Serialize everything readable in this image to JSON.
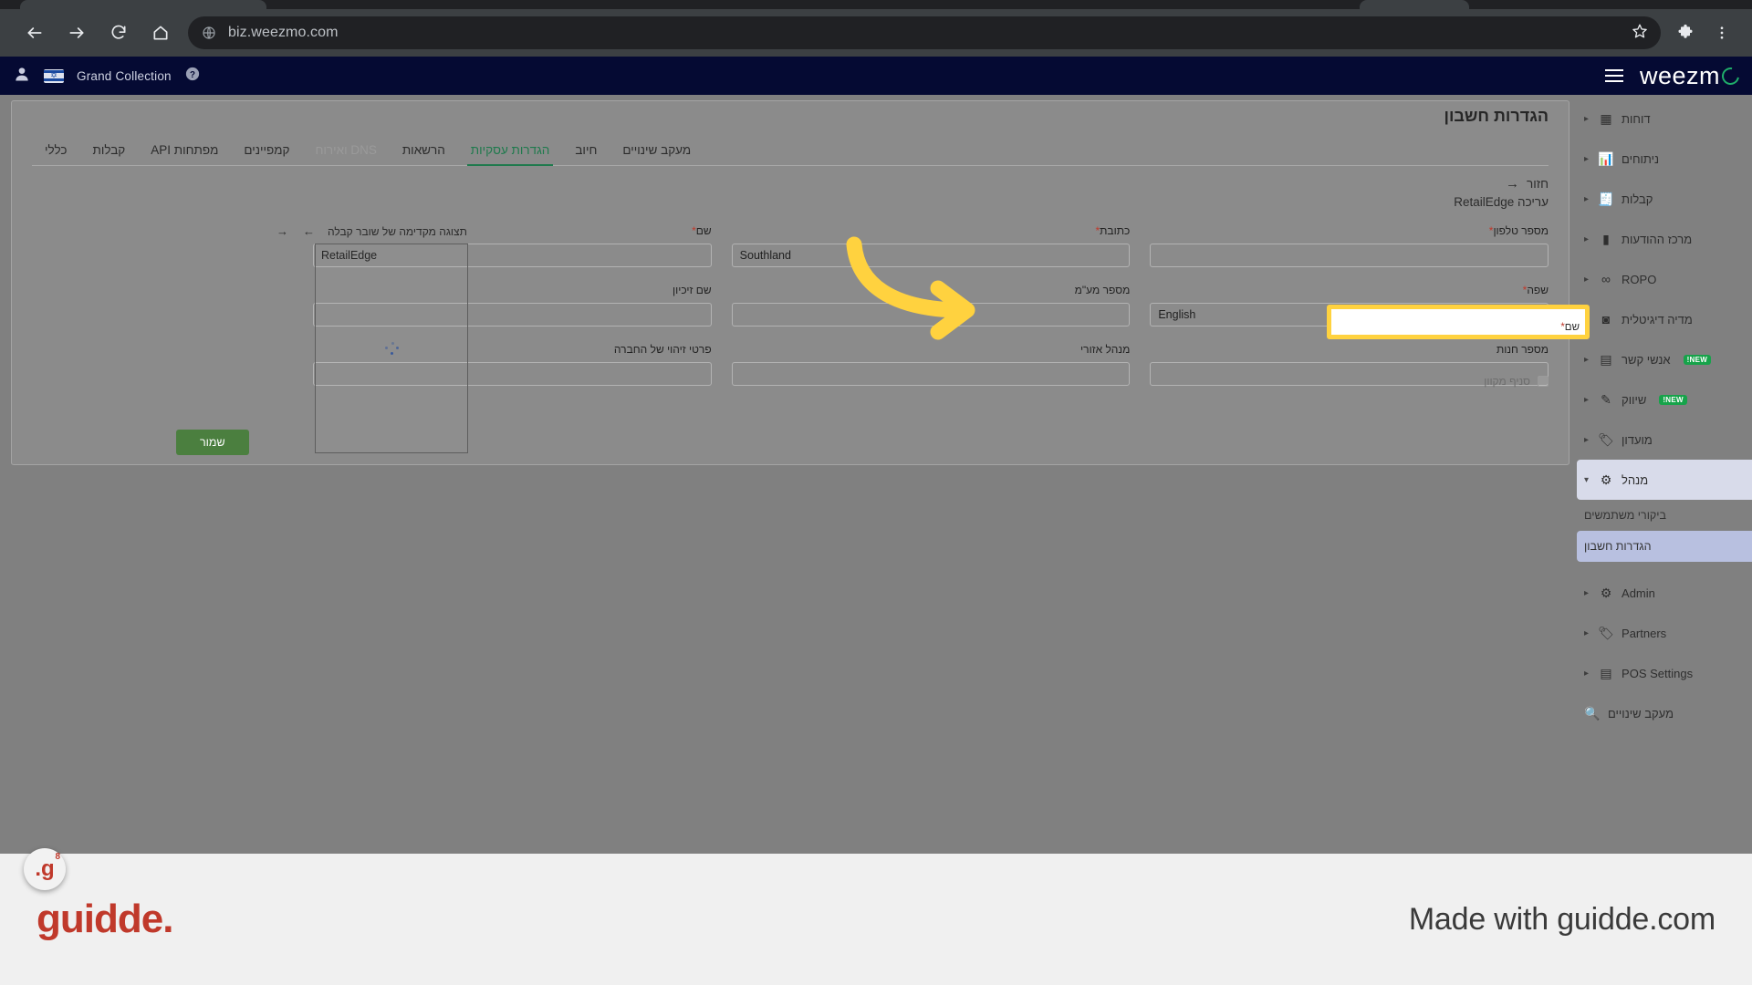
{
  "browser": {
    "url": "biz.weezmo.com",
    "back_icon": "back-arrow-icon",
    "forward_icon": "forward-arrow-icon",
    "reload_icon": "reload-icon",
    "home_icon": "home-icon",
    "site_icon": "globe-icon",
    "bookmark_icon": "star-icon",
    "extensions_icon": "puzzle-icon",
    "menu_icon": "three-dot-menu-icon"
  },
  "appbar": {
    "account_name": "Grand Collection",
    "brand": "weezm",
    "profile_icon": "account-circle-icon",
    "flag_icon": "israel-flag-icon",
    "help_icon": "question-mark-icon",
    "menu_icon": "hamburger-icon"
  },
  "sidebar": {
    "items": [
      {
        "label": "דוחות",
        "icon": "reports-icon",
        "chevron": "▸"
      },
      {
        "label": "ניתוחים",
        "icon": "analytics-icon",
        "chevron": "▸"
      },
      {
        "label": "קבלות",
        "icon": "receipts-icon",
        "chevron": "▸"
      },
      {
        "label": "מרכז ההודעות",
        "icon": "messages-icon",
        "chevron": "▸"
      },
      {
        "label": "ROPO",
        "icon": "infinity-icon",
        "chevron": "▸"
      },
      {
        "label": "מדיה דיגיטלית",
        "icon": "digital-media-icon",
        "chevron": "▸"
      },
      {
        "label": "אנשי קשר",
        "icon": "contacts-icon",
        "chevron": "▸",
        "badge": "NEW!"
      },
      {
        "label": "שיווק",
        "icon": "marketing-icon",
        "chevron": "▸",
        "badge": "NEW!"
      },
      {
        "label": "מועדון",
        "icon": "club-icon",
        "chevron": "▸"
      }
    ],
    "admin_group": {
      "label": "מנהל",
      "icon": "gear-icon",
      "chevron": "▾"
    },
    "admin_children": [
      {
        "label": "ביקורי משתמשים",
        "current": false
      },
      {
        "label": "הגדרות חשבון",
        "current": true
      }
    ],
    "bottom_items": [
      {
        "label": "Admin",
        "icon": "admin-gear-icon",
        "chevron": "▸"
      },
      {
        "label": "Partners",
        "icon": "partners-icon",
        "chevron": "▸"
      },
      {
        "label": "POS Settings",
        "icon": "pos-icon",
        "chevron": "▸"
      },
      {
        "label": "מעקב שינויים",
        "icon": "search-icon",
        "chevron": ""
      }
    ]
  },
  "main": {
    "page_title": "הגדרות חשבון",
    "tabs": [
      {
        "label": "כללי",
        "state": "normal"
      },
      {
        "label": "קבלות",
        "state": "normal"
      },
      {
        "label": "מפתחות API",
        "state": "normal"
      },
      {
        "label": "קמפיינים",
        "state": "normal"
      },
      {
        "label": "DNS ואירוח",
        "state": "disabled"
      },
      {
        "label": "הרשאות",
        "state": "normal"
      },
      {
        "label": "הגדרות עסקיות",
        "state": "selected"
      },
      {
        "label": "חיוב",
        "state": "normal"
      },
      {
        "label": "מעקב שינויים",
        "state": "normal"
      }
    ],
    "back_label": "חזור",
    "back_icon": "arrow-right-icon",
    "sub_title": "עריכה RetailEdge",
    "form": {
      "rows": [
        [
          {
            "label": "שם",
            "required": true,
            "value": "RetailEdge",
            "type": "text",
            "highlighted": true
          },
          {
            "label": "כתובת",
            "required": true,
            "value": "Southland",
            "type": "text"
          },
          {
            "label": "מספר טלפון",
            "required": true,
            "value": "",
            "type": "text"
          }
        ],
        [
          {
            "label": "שם זיכיון",
            "required": false,
            "value": "",
            "type": "text"
          },
          {
            "label": "מספר מע\"מ",
            "required": false,
            "value": "",
            "type": "text"
          },
          {
            "label": "שפה",
            "required": true,
            "value": "English",
            "type": "select",
            "caret": "⌄"
          }
        ],
        [
          {
            "label": "פרטי זיהוי של החברה",
            "required": false,
            "value": "",
            "type": "text"
          },
          {
            "label": "מנהל אזורי",
            "required": false,
            "value": "",
            "type": "text"
          },
          {
            "label": "מספר חנות",
            "required": false,
            "value": "",
            "type": "text"
          }
        ]
      ],
      "checkbox_label": "סניף מקוון",
      "save_label": "שמור"
    },
    "preview": {
      "title": "תצוגה מקדימה של שובר קבלה",
      "prev_icon": "→",
      "next_icon": "←"
    }
  },
  "annotation": {
    "arrow_color": "#FFD23F",
    "highlight_border_color": "#FFD23F",
    "highlight_field_label": "שם"
  },
  "guidde": {
    "badge_mark": "g.",
    "badge_count": "8",
    "logo": "guidde.",
    "made_with": "Made with guidde.com"
  }
}
